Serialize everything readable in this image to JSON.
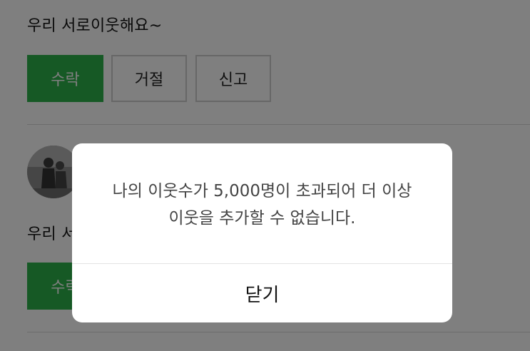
{
  "request1": {
    "message": "우리 서로이웃해요~",
    "accept_label": "수락",
    "reject_label": "거절",
    "report_label": "신고"
  },
  "request2": {
    "message": "우리 서로이웃해요~",
    "accept_label": "수락"
  },
  "dialog": {
    "message_line1": "나의 이웃수가 5,000명이 초과되어 더 이상",
    "message_line2": "이웃을 추가할 수 없습니다.",
    "close_label": "닫기"
  },
  "colors": {
    "accent": "#2db34a",
    "overlay": "rgba(0,0,0,0.5)"
  }
}
